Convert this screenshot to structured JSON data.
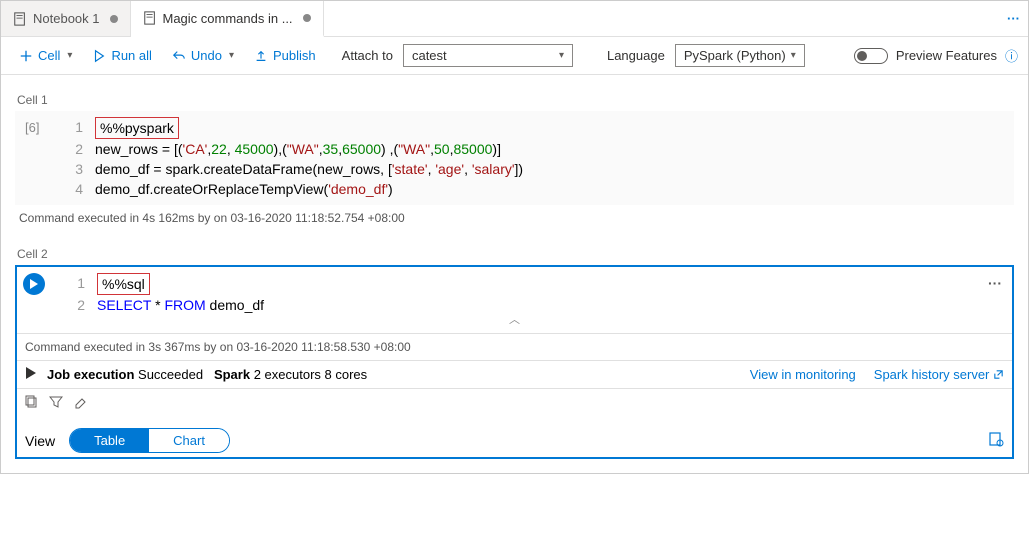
{
  "tabs": {
    "items": [
      {
        "label": "Notebook 1",
        "dirty": true,
        "active": false
      },
      {
        "label": "Magic commands in ...",
        "dirty": true,
        "active": true
      }
    ]
  },
  "toolbar": {
    "cell": "Cell",
    "run_all": "Run all",
    "undo": "Undo",
    "publish": "Publish",
    "attach_label": "Attach to",
    "attach_value": "catest",
    "language_label": "Language",
    "language_value": "PySpark (Python)",
    "preview": "Preview Features"
  },
  "cells": [
    {
      "label": "Cell 1",
      "exec_count": "[6]",
      "lines": [
        {
          "n": "1",
          "magic": "%%pyspark"
        },
        {
          "n": "2",
          "segments": [
            {
              "t": "new_rows = [("
            },
            {
              "t": "'CA'",
              "c": "kw-str"
            },
            {
              "t": ","
            },
            {
              "t": "22",
              "c": "kw-num"
            },
            {
              "t": ", "
            },
            {
              "t": "45000",
              "c": "kw-num"
            },
            {
              "t": "),("
            },
            {
              "t": "\"WA\"",
              "c": "kw-str"
            },
            {
              "t": ","
            },
            {
              "t": "35",
              "c": "kw-num"
            },
            {
              "t": ","
            },
            {
              "t": "65000",
              "c": "kw-num"
            },
            {
              "t": ") ,("
            },
            {
              "t": "\"WA\"",
              "c": "kw-str"
            },
            {
              "t": ","
            },
            {
              "t": "50",
              "c": "kw-num"
            },
            {
              "t": ","
            },
            {
              "t": "85000",
              "c": "kw-num"
            },
            {
              "t": ")]"
            }
          ]
        },
        {
          "n": "3",
          "segments": [
            {
              "t": "demo_df = spark.createDataFrame(new_rows, ["
            },
            {
              "t": "'state'",
              "c": "kw-str"
            },
            {
              "t": ", "
            },
            {
              "t": "'age'",
              "c": "kw-str"
            },
            {
              "t": ", "
            },
            {
              "t": "'salary'",
              "c": "kw-str"
            },
            {
              "t": "])"
            }
          ]
        },
        {
          "n": "4",
          "segments": [
            {
              "t": "demo_df.createOrReplaceTempView("
            },
            {
              "t": "'demo_df'",
              "c": "kw-str"
            },
            {
              "t": ")"
            }
          ]
        }
      ],
      "status": "Command executed in 4s 162ms by       on 03-16-2020 11:18:52.754 +08:00"
    },
    {
      "label": "Cell 2",
      "lines": [
        {
          "n": "1",
          "magic": "%%sql"
        },
        {
          "n": "2",
          "segments": [
            {
              "t": "SELECT",
              "c": "kw-blue"
            },
            {
              "t": " * "
            },
            {
              "t": "FROM",
              "c": "kw-blue"
            },
            {
              "t": " demo_df"
            }
          ]
        }
      ],
      "status": "Command executed in 3s 367ms by       on 03-16-2020 11:18:58.530 +08:00",
      "job": {
        "label": "Job execution ",
        "result": "Succeeded",
        "spark_label": "Spark",
        "spark_detail": "2 executors 8 cores",
        "monitoring": "View in monitoring",
        "history": "Spark history server"
      },
      "view": {
        "label": "View",
        "table": "Table",
        "chart": "Chart"
      }
    }
  ]
}
